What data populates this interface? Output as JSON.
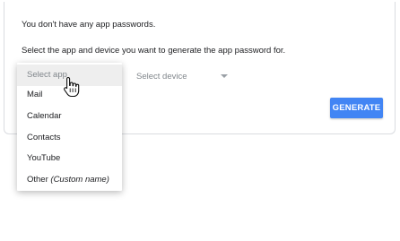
{
  "card": {
    "no_passwords_message": "You don't have any app passwords.",
    "instruction": "Select the app and device you want to generate the app password for."
  },
  "app_select": {
    "placeholder": "Select app",
    "options": [
      {
        "label": "Mail"
      },
      {
        "label": "Calendar"
      },
      {
        "label": "Contacts"
      },
      {
        "label": "YouTube"
      },
      {
        "label": "Other",
        "suffix": "(Custom name)"
      }
    ]
  },
  "device_select": {
    "placeholder": "Select device",
    "caret_icon": "caret-down-icon"
  },
  "generate_button": {
    "label": "GENERATE",
    "color": "#4285f4"
  },
  "cursor": {
    "icon": "hand-pointer-icon"
  }
}
